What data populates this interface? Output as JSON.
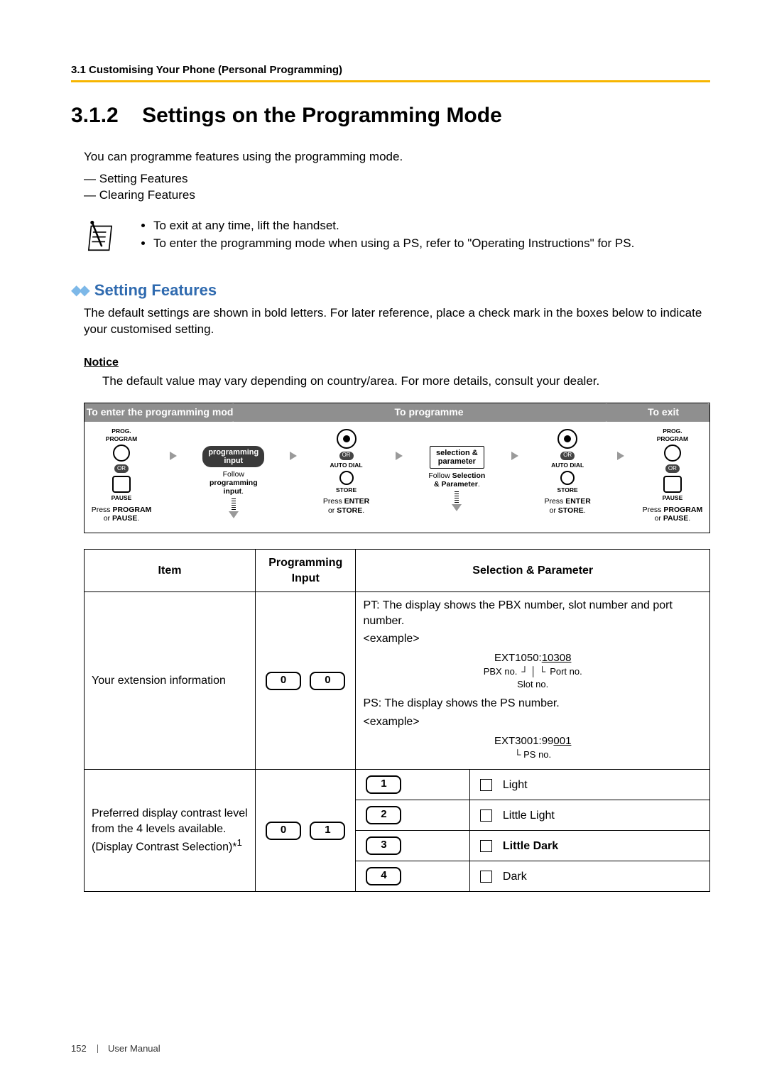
{
  "running_head": "3.1 Customising Your Phone (Personal Programming)",
  "heading_number": "3.1.2",
  "heading_title": "Settings on the Programming Mode",
  "intro": "You can programme features using the programming mode.",
  "dash_items": [
    "Setting Features",
    "Clearing Features"
  ],
  "note_bullets": [
    "To exit at any time, lift the handset.",
    "To enter the programming mode when using a PS, refer to \"Operating Instructions\" for PS."
  ],
  "subhead": "Setting Features",
  "subhead_para": "The default settings are shown in bold letters. For later reference, place a check mark in the boxes below to indicate your customised setting.",
  "notice_label": "Notice",
  "notice_text": "The default value may vary depending on country/area. For more details, consult your dealer.",
  "flow": {
    "header": {
      "left": "To enter the programming mode",
      "mid": "To programme",
      "right": "To exit"
    },
    "labels": {
      "prog_program": "PROG.\nPROGRAM",
      "or": "OR",
      "pause": "PAUSE",
      "auto_dial": "AUTO DIAL",
      "store": "STORE",
      "programming_input_pill": "programming\ninput",
      "sel_param_pill": "selection &\nparameter"
    },
    "captions": {
      "step1": {
        "a": "Press ",
        "b": "PROGRAM",
        "c": "\nor ",
        "d": "PAUSE",
        "e": "."
      },
      "step2": {
        "a": "Follow\n",
        "b": "programming\ninput",
        "c": "."
      },
      "step3": {
        "a": "Press ",
        "b": "ENTER",
        "c": "\nor ",
        "d": "STORE",
        "e": "."
      },
      "step4": {
        "a": "Follow ",
        "b": "Selection\n& Parameter",
        "c": "."
      },
      "step5": {
        "a": "Press ",
        "b": "ENTER",
        "c": "\nor ",
        "d": "STORE",
        "e": "."
      },
      "step6": {
        "a": "Press ",
        "b": "PROGRAM",
        "c": "\nor ",
        "d": "PAUSE",
        "e": "."
      }
    }
  },
  "table": {
    "headers": {
      "item": "Item",
      "prog": "Programming\nInput",
      "sel": "Selection & Parameter"
    },
    "row1": {
      "item": "Your extension information",
      "keys": [
        "0",
        "0"
      ],
      "pt_line1": "PT: The display shows the PBX number, slot number and port number.",
      "example_tag": "<example>",
      "pt_example": "EXT1050:10308",
      "pt_ann_pbx": "PBX no.",
      "pt_ann_slot": "Slot no.",
      "pt_ann_port": "Port no.",
      "ps_line1": "PS: The display shows the PS number.",
      "ps_example": "EXT3001:99001",
      "ps_ann": "PS no."
    },
    "row2": {
      "item_l1": "Preferred display contrast level from the 4 levels available.",
      "item_l2": "(Display Contrast Selection)*",
      "item_sup": "1",
      "keys": [
        "0",
        "1"
      ],
      "opts": [
        {
          "key": "1",
          "label": "Light",
          "bold": false
        },
        {
          "key": "2",
          "label": "Little Light",
          "bold": false
        },
        {
          "key": "3",
          "label": "Little Dark",
          "bold": true
        },
        {
          "key": "4",
          "label": "Dark",
          "bold": false
        }
      ]
    }
  },
  "footer": {
    "page": "152",
    "label": "User Manual"
  }
}
